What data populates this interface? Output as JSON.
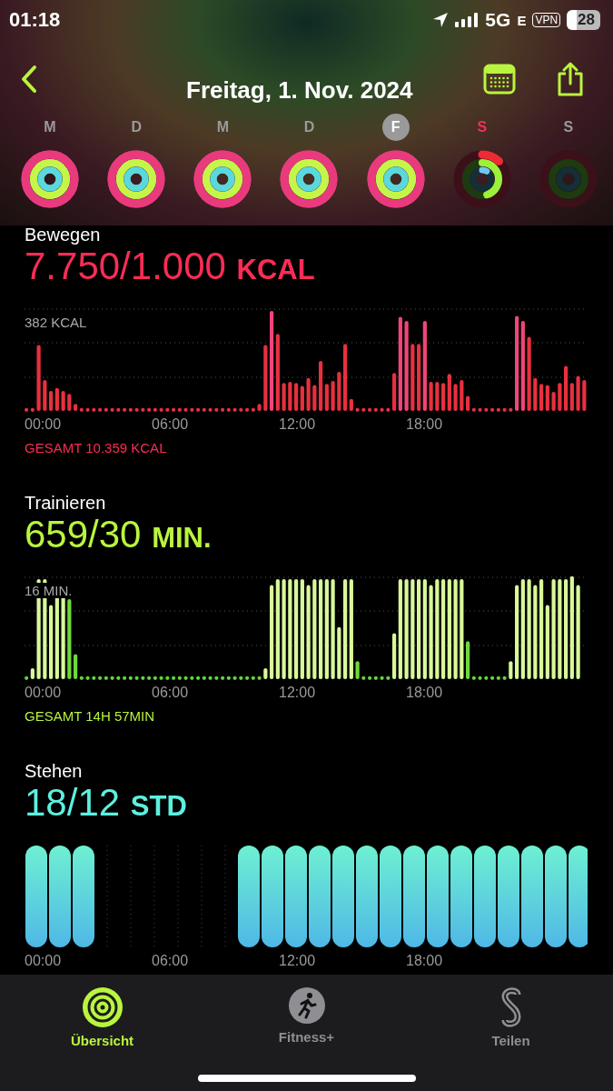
{
  "status_bar": {
    "time": "01:18",
    "network": "5G",
    "network_secondary": "E",
    "vpn": "VPN",
    "battery": "28"
  },
  "nav": {
    "title": "Freitag, 1. Nov. 2024"
  },
  "days": [
    {
      "letter": "M",
      "selected": false,
      "today": false,
      "kind": "closed"
    },
    {
      "letter": "D",
      "selected": false,
      "today": false,
      "kind": "closed"
    },
    {
      "letter": "M",
      "selected": false,
      "today": false,
      "kind": "closed"
    },
    {
      "letter": "D",
      "selected": false,
      "today": false,
      "kind": "closed"
    },
    {
      "letter": "F",
      "selected": true,
      "today": false,
      "kind": "closed"
    },
    {
      "letter": "S",
      "selected": false,
      "today": true,
      "kind": "partial"
    },
    {
      "letter": "S",
      "selected": false,
      "today": false,
      "kind": "empty"
    }
  ],
  "sections": [
    {
      "kind": "move",
      "title": "Bewegen",
      "value": "7.750/1.000",
      "unit": "KCAL",
      "y_label": "382 KCAL",
      "x_labels": [
        "00:00",
        "06:00",
        "12:00",
        "18:00"
      ],
      "total": "GESAMT 10.359 KCAL"
    },
    {
      "kind": "exercise",
      "title": "Trainieren",
      "value": "659/30",
      "unit": "MIN.",
      "y_label": "16 MIN.",
      "x_labels": [
        "00:00",
        "06:00",
        "12:00",
        "18:00"
      ],
      "total": "GESAMT 14H 57MIN"
    },
    {
      "kind": "stand",
      "title": "Stehen",
      "value": "18/12",
      "unit": "STD",
      "x_labels": [
        "00:00",
        "06:00",
        "12:00",
        "18:00"
      ]
    }
  ],
  "tab_bar": [
    {
      "label": "Übersicht",
      "selected": true,
      "kind": "summary"
    },
    {
      "label": "Fitness+",
      "selected": false,
      "kind": "fitness"
    },
    {
      "label": "Teilen",
      "selected": false,
      "kind": "sharing"
    }
  ]
}
